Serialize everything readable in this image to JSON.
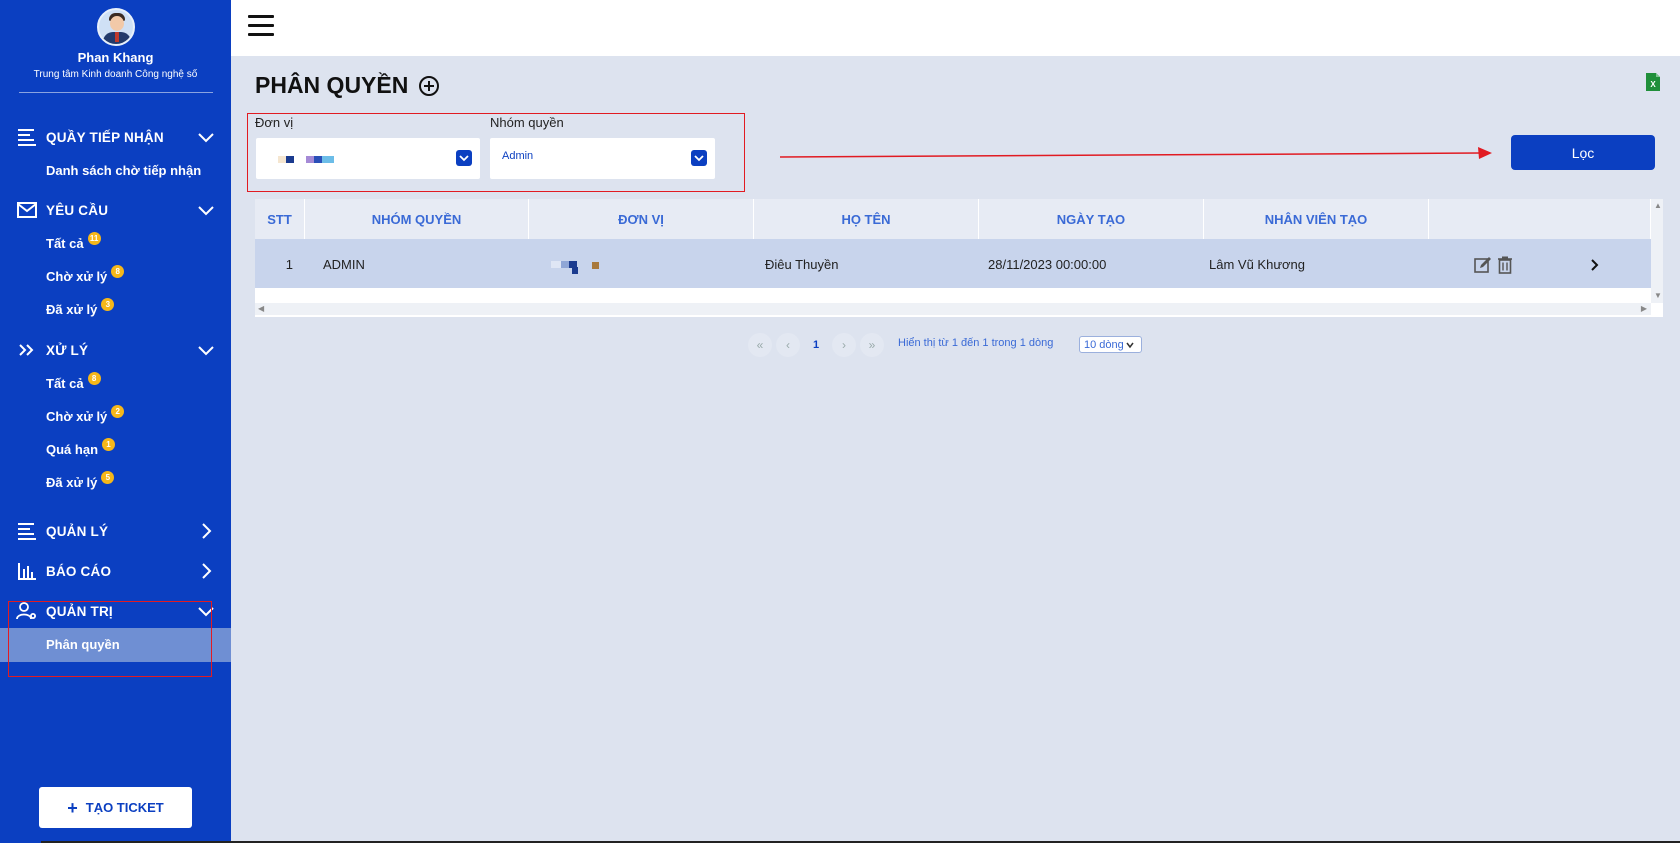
{
  "profile": {
    "name": "Phan Khang",
    "org": "Trung tâm Kinh doanh Công nghệ số"
  },
  "menu": {
    "quay": {
      "label": "QUẦY TIẾP NHẬN",
      "items": [
        {
          "label": "Danh sách chờ tiếp nhận"
        }
      ]
    },
    "yeucau": {
      "label": "YÊU CẦU",
      "items": [
        {
          "label": "Tất cả",
          "badge": "11"
        },
        {
          "label": "Chờ xử lý",
          "badge": "8"
        },
        {
          "label": "Đã xử lý",
          "badge": "3"
        }
      ]
    },
    "xuly": {
      "label": "XỬ LÝ",
      "items": [
        {
          "label": "Tất cả",
          "badge": "8"
        },
        {
          "label": "Chờ xử lý",
          "badge": "2"
        },
        {
          "label": "Quá hạn",
          "badge": "1"
        },
        {
          "label": "Đã xử lý",
          "badge": "5"
        }
      ]
    },
    "quanly": {
      "label": "QUẢN LÝ"
    },
    "baocao": {
      "label": "BÁO CÁO"
    },
    "quantri": {
      "label": "QUẢN TRỊ",
      "items": [
        {
          "label": "Phân quyền"
        }
      ]
    }
  },
  "create_button": "TẠO TICKET",
  "page": {
    "title": "PHÂN QUYỀN"
  },
  "filters": {
    "donvi_label": "Đơn vị",
    "nhomquyen_label": "Nhóm quyền",
    "nhomquyen_value": "Admin",
    "filter_button": "Lọc"
  },
  "table": {
    "headers": [
      "STT",
      "NHÓM QUYỀN",
      "ĐƠN VỊ",
      "HỌ TÊN",
      "NGÀY TẠO",
      "NHÂN VIÊN TẠO"
    ],
    "rows": [
      {
        "stt": "1",
        "nhomquyen": "ADMIN",
        "hoten": "Điêu Thuyền",
        "ngaytao": "28/11/2023 00:00:00",
        "nhanvien": "Lâm Vũ Khương"
      }
    ]
  },
  "pagination": {
    "first": "«",
    "prev": "‹",
    "current": "1",
    "next": "›",
    "last": "»",
    "info": "Hiển thị từ 1 đến 1 trong 1 dòng",
    "page_size": "10 dòng"
  },
  "colors": {
    "sidebar": "#0b3fc1",
    "accent": "#0b3fc1",
    "highlight": "#e11b22",
    "badge": "#f5b71a"
  }
}
